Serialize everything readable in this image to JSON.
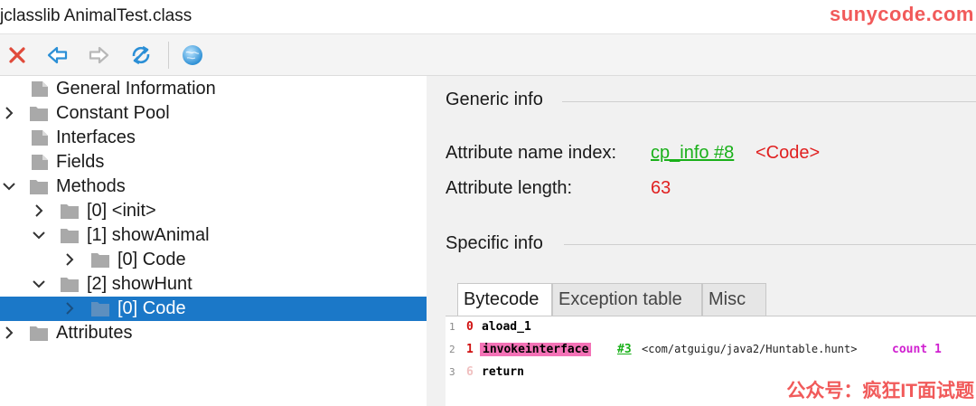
{
  "window": {
    "title": "jclasslib AnimalTest.class"
  },
  "watermarks": {
    "top": "sunycode.com",
    "bottom": "公众号：疯狂IT面试题"
  },
  "toolbar": {
    "buttons": [
      {
        "name": "close",
        "icon": "close-icon",
        "color": "#e04a3a"
      },
      {
        "name": "back",
        "icon": "arrow-left-icon",
        "color": "#2b8fd6"
      },
      {
        "name": "forward",
        "icon": "arrow-right-icon",
        "color": "#b8b8b8"
      },
      {
        "name": "reload",
        "icon": "refresh-icon",
        "color": "#2b8fd6"
      },
      {
        "name": "web",
        "icon": "globe-icon",
        "color": "#3aa0e0"
      }
    ]
  },
  "tree": {
    "items": [
      {
        "label": "General Information",
        "expander": "none"
      },
      {
        "label": "Constant Pool",
        "expander": "collapsed"
      },
      {
        "label": "Interfaces",
        "expander": "none"
      },
      {
        "label": "Fields",
        "expander": "none"
      },
      {
        "label": "Methods",
        "expander": "expanded"
      },
      {
        "label": "[0] <init>",
        "expander": "collapsed"
      },
      {
        "label": "[1] showAnimal",
        "expander": "expanded"
      },
      {
        "label": "[0] Code",
        "expander": "collapsed"
      },
      {
        "label": "[2] showHunt",
        "expander": "expanded"
      },
      {
        "label": "[0] Code",
        "expander": "collapsed",
        "selected": true
      },
      {
        "label": "Attributes",
        "expander": "collapsed"
      }
    ]
  },
  "generic": {
    "title": "Generic info",
    "name_index_label": "Attribute name index:",
    "name_index_link": "cp_info #8",
    "name_index_value": "<Code>",
    "length_label": "Attribute length:",
    "length_value": "63"
  },
  "specific": {
    "title": "Specific info"
  },
  "tabs": [
    {
      "label": "Bytecode",
      "active": true
    },
    {
      "label": "Exception table",
      "active": false
    },
    {
      "label": "Misc",
      "active": false
    }
  ],
  "bytecode": [
    {
      "line": "1",
      "offset": "0",
      "instr": "aload_1"
    },
    {
      "line": "2",
      "offset": "1",
      "instr": "invokeinterface",
      "ref": "#3",
      "cls": "<com/atguigu/java2/Huntable.hunt>",
      "kw": "count 1"
    },
    {
      "line": "3",
      "offset": "6",
      "instr": "return"
    }
  ]
}
